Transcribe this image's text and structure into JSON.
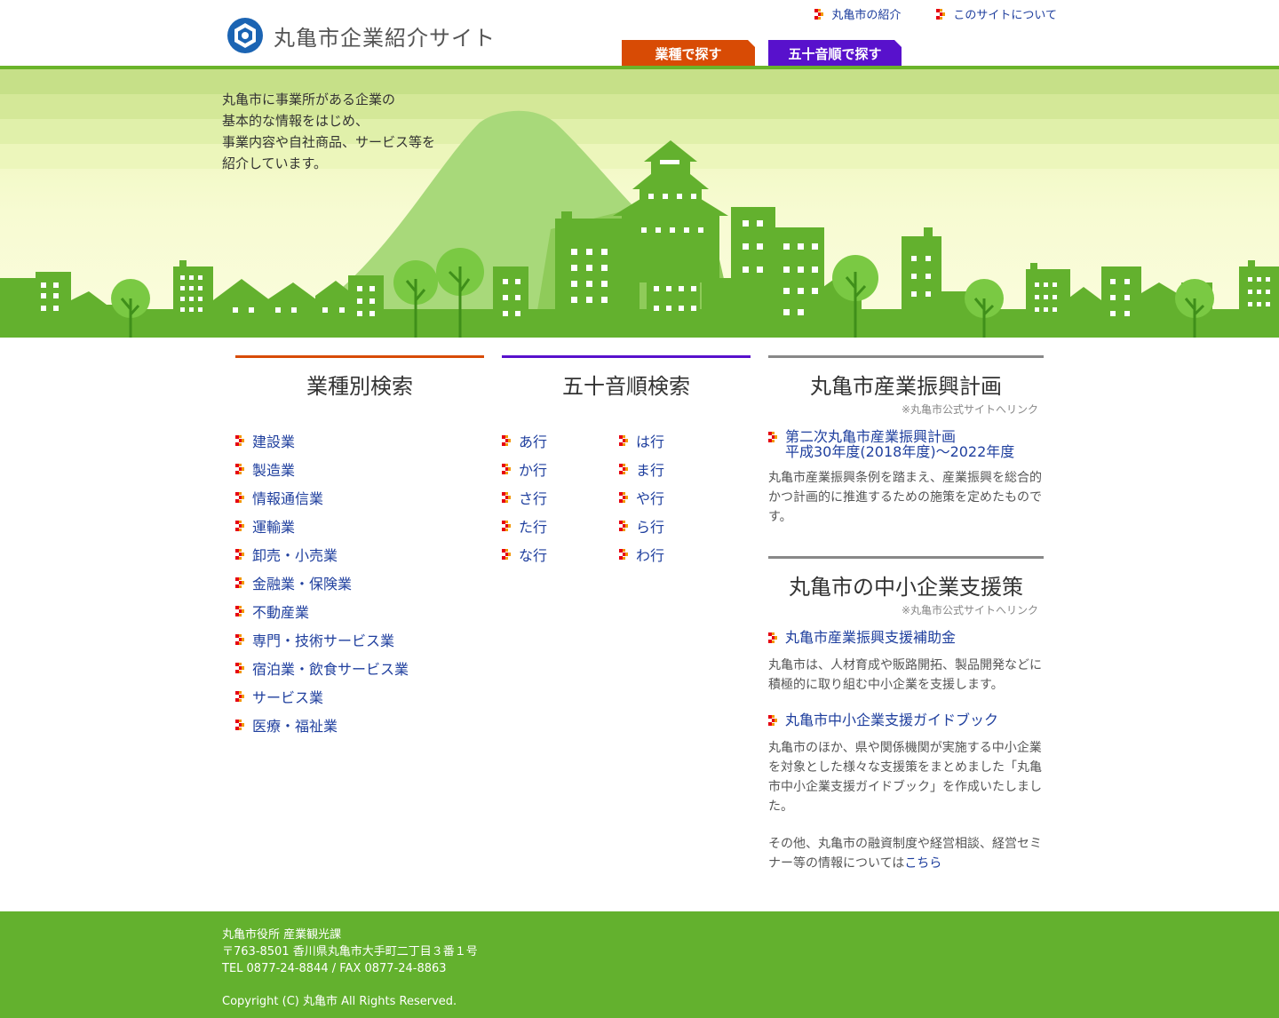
{
  "site": {
    "title": "丸亀市企業紹介サイト"
  },
  "top_links": [
    {
      "label": "丸亀市の紹介"
    },
    {
      "label": "このサイトについて"
    }
  ],
  "tabs": {
    "by_industry": "業種で探す",
    "by_kana": "五十音順で探す"
  },
  "colors": {
    "accent_green": "#63b12e",
    "tab_orange": "#d84b05",
    "tab_purple": "#5811cc",
    "link_blue": "#1f3f9e"
  },
  "hero": {
    "lines": [
      "丸亀市に事業所がある企業の",
      "基本的な情報をはじめ、",
      "事業内容や自社商品、サービス等を",
      "紹介しています。"
    ]
  },
  "industry": {
    "title": "業種別検索",
    "items": [
      "建設業",
      "製造業",
      "情報通信業",
      "運輸業",
      "卸売・小売業",
      "金融業・保険業",
      "不動産業",
      "専門・技術サービス業",
      "宿泊業・飲食サービス業",
      "サービス業",
      "医療・福祉業"
    ]
  },
  "kana": {
    "title": "五十音順検索",
    "items": [
      "あ行",
      "は行",
      "か行",
      "ま行",
      "さ行",
      "や行",
      "た行",
      "ら行",
      "な行",
      "わ行"
    ]
  },
  "plan": {
    "title": "丸亀市産業振興計画",
    "note": "※丸亀市公式サイトへリンク",
    "link_line1": "第二次丸亀市産業振興計画",
    "link_line2": "平成30年度(2018年度)～2022年度",
    "desc": "丸亀市産業振興条例を踏まえ、産業振興を総合的かつ計画的に推進するための施策を定めたものです。"
  },
  "support": {
    "title": "丸亀市の中小企業支援策",
    "note": "※丸亀市公式サイトへリンク",
    "link1": "丸亀市産業振興支援補助金",
    "desc1": "丸亀市は、人材育成や販路開拓、製品開発などに積極的に取り組む中小企業を支援します。",
    "link2": "丸亀市中小企業支援ガイドブック",
    "desc2": "丸亀市のほか、県や関係機関が実施する中小企業を対象とした様々な支援策をまとめました「丸亀市中小企業支援ガイドブック」を作成いたしました。",
    "other_prefix": "その他、丸亀市の融資制度や経営相談、経営セミナー等の情報については",
    "other_link": "こちら"
  },
  "footer": {
    "line1": "丸亀市役所 産業観光課",
    "line2": "〒763-8501 香川県丸亀市大手町二丁目３番１号",
    "line3": "TEL 0877-24-8844 / FAX 0877-24-8863",
    "copyright": "Copyright (C) 丸亀市 All Rights Reserved."
  }
}
